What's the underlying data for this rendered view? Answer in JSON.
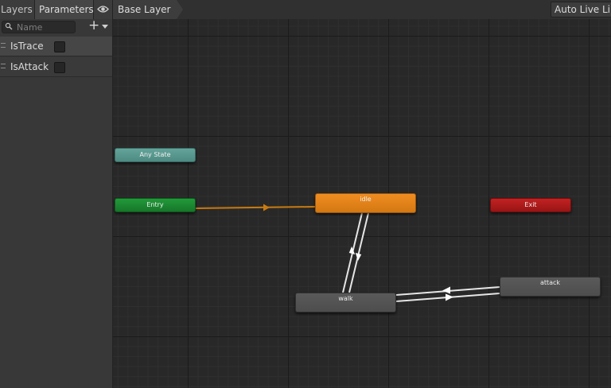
{
  "left_panel": {
    "tabs": [
      {
        "label": "Layers"
      },
      {
        "label": "Parameters"
      }
    ],
    "eye_icon": "eye-icon",
    "search": {
      "placeholder": "Name",
      "value": "",
      "icon": "search-icon"
    },
    "add_button": {
      "label": "+"
    },
    "parameters": [
      {
        "name": "IsTrace",
        "checked": false
      },
      {
        "name": "IsAttack",
        "checked": false
      }
    ]
  },
  "top_bar": {
    "breadcrumb": "Base Layer",
    "auto_live_link": "Auto Live Lin"
  },
  "graph": {
    "states": {
      "any_state": {
        "label": "Any State",
        "color": "#5b9b91"
      },
      "entry": {
        "label": "Entry",
        "color": "#1e8a34"
      },
      "exit": {
        "label": "Exit",
        "color": "#b21c1c"
      },
      "idle": {
        "label": "idle",
        "color": "#e88419"
      },
      "walk": {
        "label": "walk",
        "color": "#545454"
      },
      "attack": {
        "label": "attack",
        "color": "#545454"
      }
    },
    "transitions": [
      {
        "from": "Entry",
        "to": "idle",
        "color": "#c87a10"
      },
      {
        "from": "idle",
        "to": "walk",
        "color": "#e6e6e6"
      },
      {
        "from": "walk",
        "to": "idle",
        "color": "#e6e6e6"
      },
      {
        "from": "walk",
        "to": "attack",
        "color": "#e6e6e6"
      },
      {
        "from": "attack",
        "to": "walk",
        "color": "#e6e6e6"
      }
    ]
  }
}
